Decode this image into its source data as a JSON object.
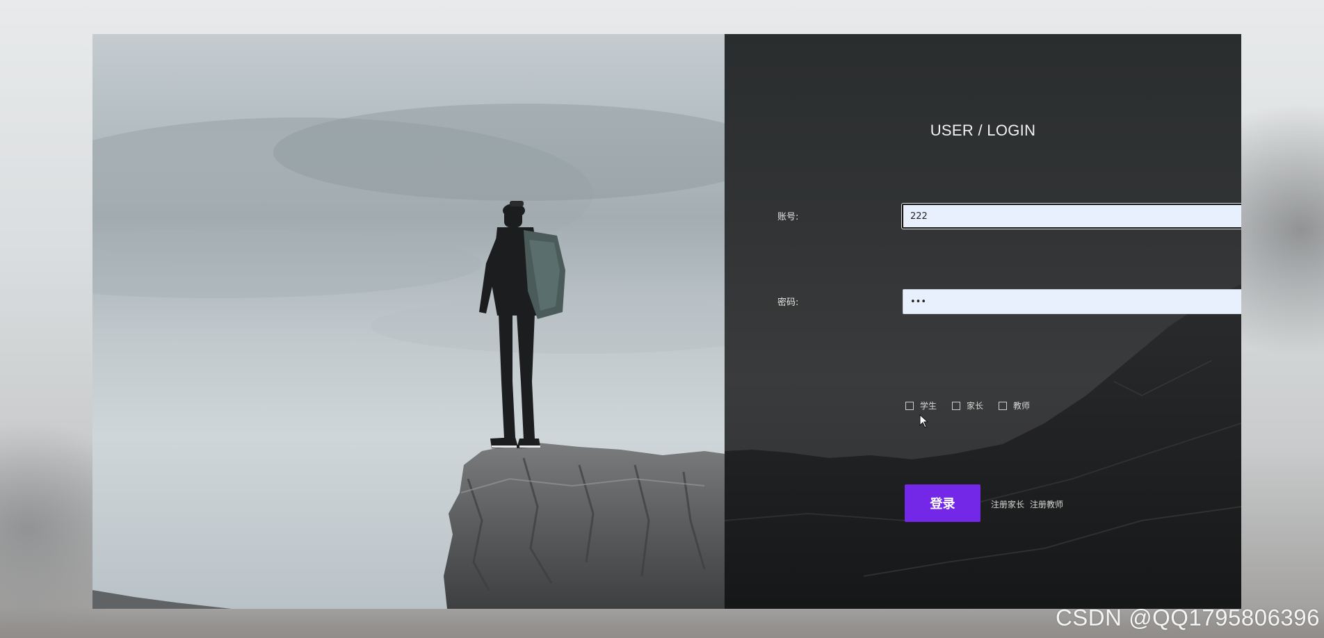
{
  "login": {
    "title": "USER / LOGIN",
    "account_label": "账号:",
    "account_value": "222",
    "password_label": "密码:",
    "password_value": "222",
    "submit_label": "登录",
    "roles": [
      {
        "label": "学生",
        "checked": false
      },
      {
        "label": "家长",
        "checked": false
      },
      {
        "label": "教师",
        "checked": false
      }
    ],
    "register_links": [
      "注册家长",
      "注册教师"
    ]
  },
  "watermark": "CSDN @QQ1795806396",
  "colors": {
    "accent": "#7228e6",
    "panel_bg": "#303233",
    "input_bg": "#e8f0fe"
  }
}
